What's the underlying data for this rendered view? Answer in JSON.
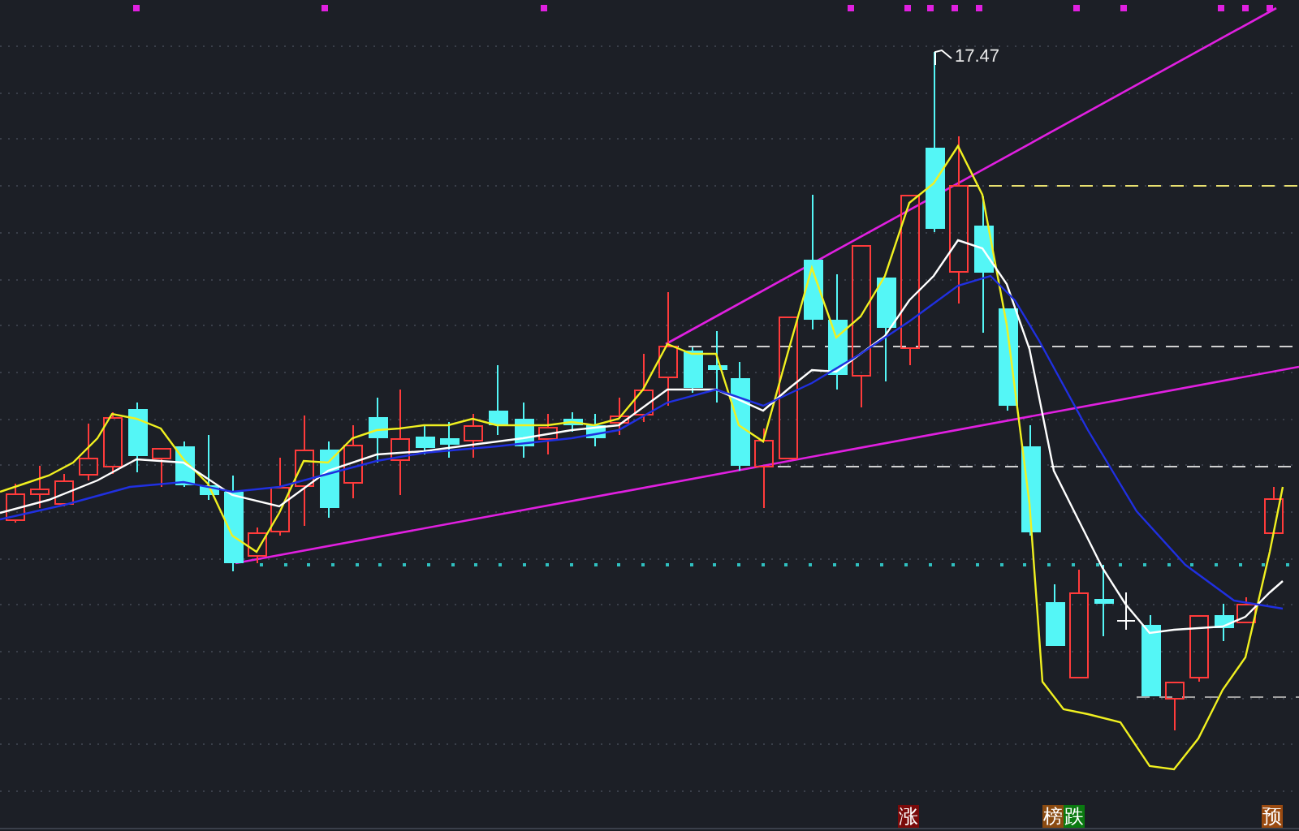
{
  "chart": {
    "high_label": "17.47"
  },
  "markers": [
    {
      "text": "涨",
      "color": "#7a0a0a"
    },
    {
      "text": "榜",
      "color": "#8a4a10"
    },
    {
      "text": "跌",
      "color": "#0a7a10"
    },
    {
      "text": "预",
      "color": "#9a4a10"
    }
  ]
}
